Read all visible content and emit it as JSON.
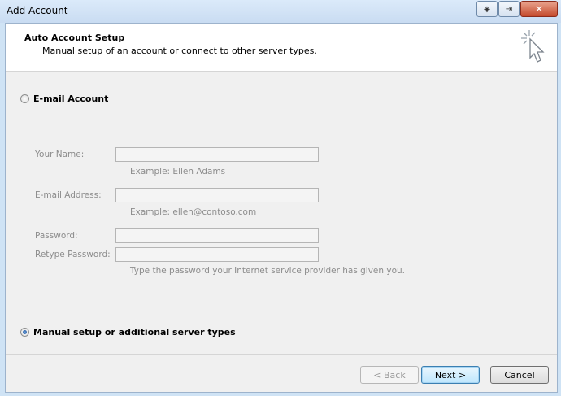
{
  "window": {
    "title": "Add Account",
    "close_glyph": "✕",
    "controls": [
      "diamond-icon",
      "restore-icon",
      "close-icon"
    ]
  },
  "header": {
    "title": "Auto Account Setup",
    "subtitle": "Manual setup of an account or connect to other server types."
  },
  "options": {
    "email_account": {
      "label": "E-mail Account",
      "selected": false
    },
    "manual_setup": {
      "label": "Manual setup or additional server types",
      "selected": true
    }
  },
  "form": {
    "your_name": {
      "label": "Your Name:",
      "value": "",
      "hint": "Example: Ellen Adams"
    },
    "email_address": {
      "label": "E-mail Address:",
      "value": "",
      "hint": "Example: ellen@contoso.com"
    },
    "password": {
      "label": "Password:",
      "value": ""
    },
    "retype_password": {
      "label": "Retype Password:",
      "value": "",
      "hint": "Type the password your Internet service provider has given you."
    }
  },
  "buttons": {
    "back": "< Back",
    "next": "Next >",
    "cancel": "Cancel"
  }
}
